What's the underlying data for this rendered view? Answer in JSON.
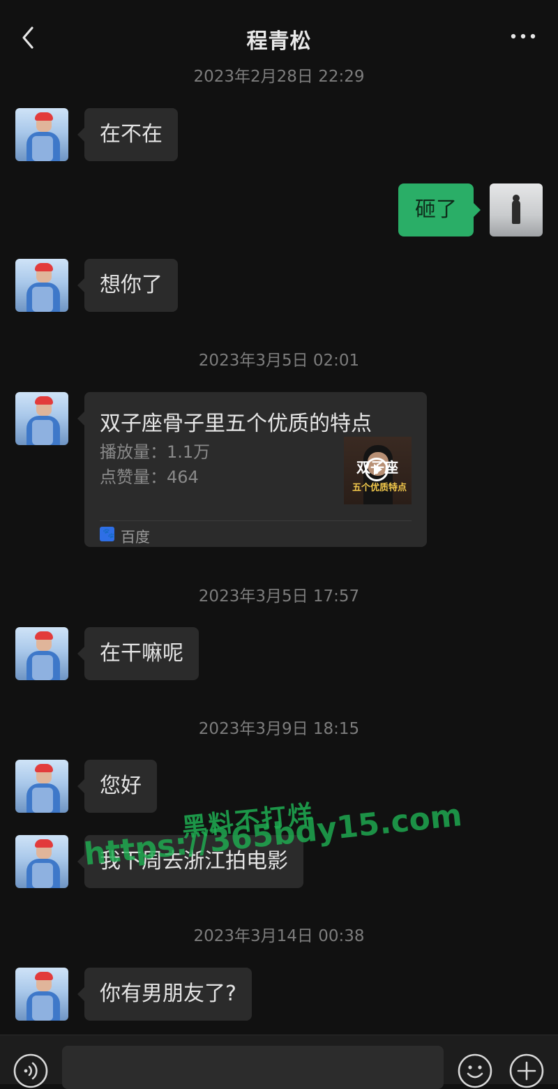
{
  "header": {
    "title": "程青松",
    "back_icon": "chevron-left-icon",
    "more_icon": "more-dots-icon"
  },
  "messages": {
    "ts1": "2023年2月28日 22:29",
    "m1": "在不在",
    "m2_me": "砸了",
    "m3": "想你了",
    "ts2": "2023年3月5日 02:01",
    "card": {
      "title": "双子座骨子里五个优质的特点",
      "play_count": "播放量：1.1万",
      "like_count": "点赞量：464",
      "thumb_text_1": "双子座",
      "thumb_text_2": "五个优质特点",
      "source": "百度"
    },
    "ts3": "2023年3月5日 17:57",
    "m4": "在干嘛呢",
    "ts4": "2023年3月9日 18:15",
    "m5": "您好",
    "m6": "我下周去浙江拍电影",
    "ts5": "2023年3月14日 00:38",
    "m7": "你有男朋友了?"
  },
  "watermark": {
    "line1": "黑料不打烊",
    "line2": "https://365bdy15.com"
  },
  "input_bar": {
    "value": "",
    "placeholder": "",
    "voice_icon": "voice-icon",
    "emoji_icon": "emoji-icon",
    "plus_icon": "plus-icon"
  },
  "colors": {
    "background": "#111111",
    "bubble_other": "#2b2b2b",
    "bubble_me": "#2aae67",
    "watermark": "#1fae52"
  }
}
